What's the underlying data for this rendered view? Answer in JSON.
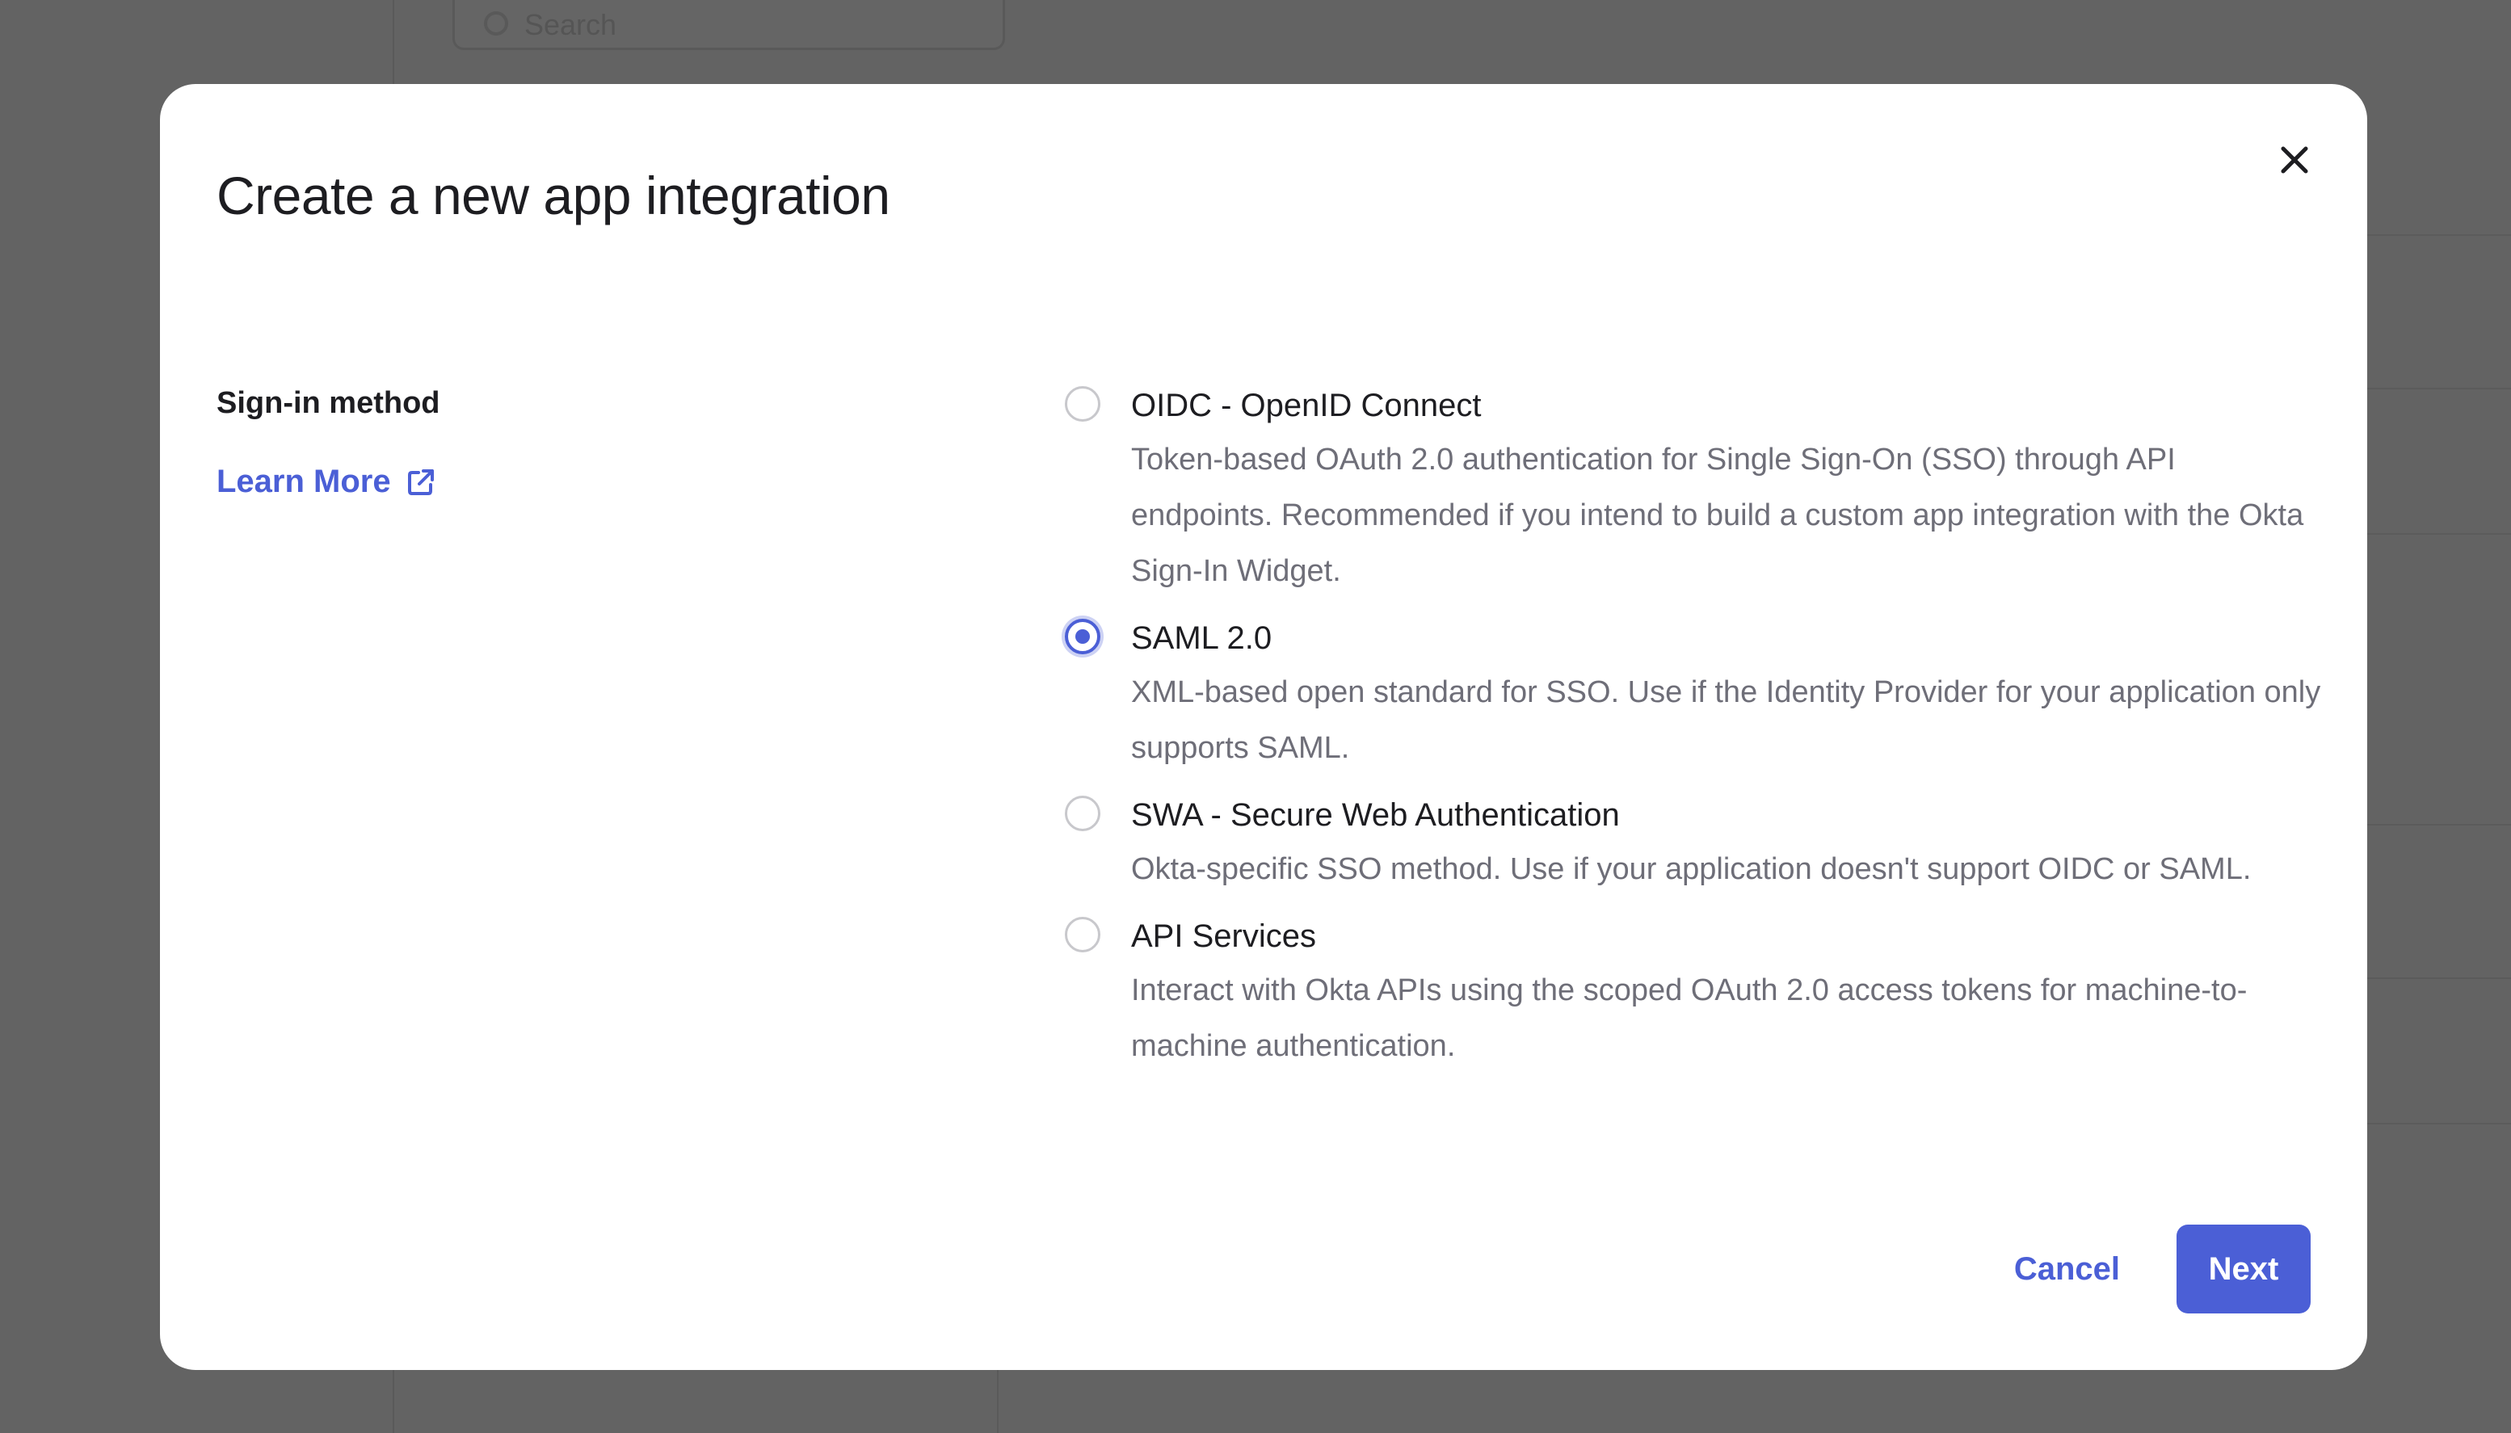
{
  "background": {
    "search_placeholder": "Search"
  },
  "modal": {
    "title": "Create a new app integration",
    "close_icon": "close-icon",
    "section_label": "Sign-in method",
    "learn_more": "Learn More",
    "learn_more_icon": "external-link-icon",
    "options": [
      {
        "label": "OIDC - OpenID Connect",
        "description": "Token-based OAuth 2.0 authentication for Single Sign-On (SSO) through API endpoints. Recommended if you intend to build a custom app integration with the Okta Sign-In Widget.",
        "selected": false
      },
      {
        "label": "SAML 2.0",
        "description": "XML-based open standard for SSO. Use if the Identity Provider for your application only supports SAML.",
        "selected": true
      },
      {
        "label": "SWA - Secure Web Authentication",
        "description": "Okta-specific SSO method. Use if your application doesn't support OIDC or SAML.",
        "selected": false
      },
      {
        "label": "API Services",
        "description": "Interact with Okta APIs using the scoped OAuth 2.0 access tokens for machine-to-machine authentication.",
        "selected": false
      }
    ],
    "cancel_label": "Cancel",
    "next_label": "Next"
  },
  "colors": {
    "accent": "#4b5fd6",
    "backdrop": "#636363",
    "text_primary": "#1d1d21",
    "text_secondary": "#6e6e78"
  }
}
